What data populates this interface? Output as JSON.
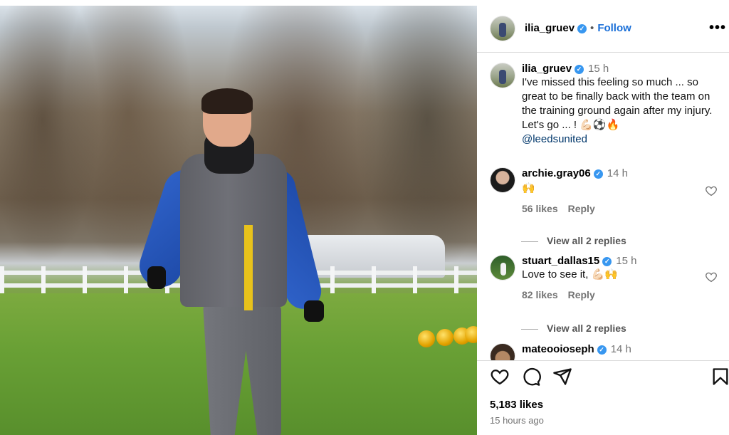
{
  "post": {
    "username": "ilia_gruev",
    "follow_label": "Follow",
    "separator": "•",
    "more_label": "•••",
    "caption": {
      "username": "ilia_gruev",
      "time": "15 h",
      "text": "I've missed this feeling so much ... so great to be finally back with the team on the training ground again after my injury. Let's go ... ! 💪🏻⚽🔥",
      "mention": "@leedsunited"
    }
  },
  "comments": [
    {
      "username": "archie.gray06",
      "time": "14 h",
      "text": "🙌",
      "likes": "56 likes",
      "reply_label": "Reply",
      "replies_label": "View all 2 replies"
    },
    {
      "username": "stuart_dallas15",
      "time": "15 h",
      "text": "Love to see it, 💪🏻🙌",
      "likes": "82 likes",
      "reply_label": "Reply",
      "replies_label": "View all 2 replies"
    },
    {
      "username": "mateooioseph",
      "time": "14 h"
    }
  ],
  "footer": {
    "likes": "5,183 likes",
    "time_ago": "15 hours ago"
  },
  "icons": {
    "verified": "verified-badge-icon",
    "like": "heart-icon",
    "comment": "comment-icon",
    "share": "send-icon",
    "save": "bookmark-icon",
    "more": "more-options-icon"
  },
  "colors": {
    "link": "#1a6fd8",
    "verified": "#3897f0",
    "muted": "#737373",
    "mention": "#00376b"
  }
}
